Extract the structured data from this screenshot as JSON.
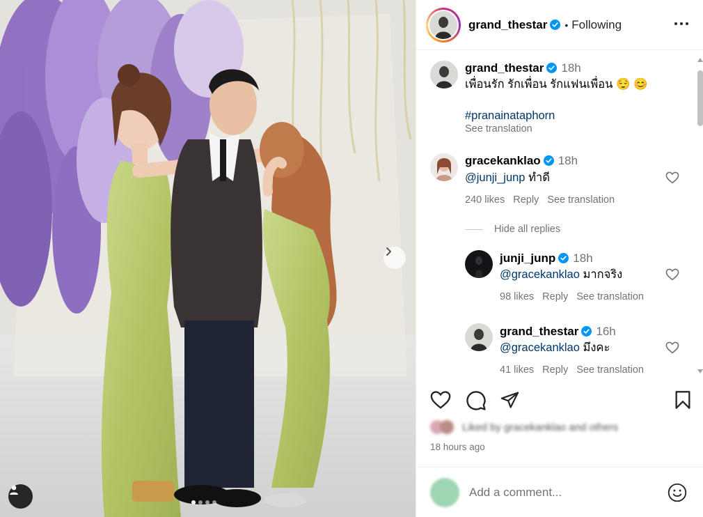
{
  "post": {
    "author": "grand_thestar",
    "separator": "•",
    "follow_status": "Following",
    "photo_count": 4,
    "active_photo": 1
  },
  "caption": {
    "username": "grand_thestar",
    "time": "18h",
    "text": "เพื่อนรัก รักเพื่อน รักแฟนเพื่อน 😌 😊",
    "hashtag": "#pranainataphorn",
    "translate": "See translation"
  },
  "comments": [
    {
      "username": "gracekankla o",
      "display": "gracekanklao",
      "time": "18h",
      "mention": "@junji_junp",
      "text": "ทำดี",
      "likes": "240 likes",
      "reply": "Reply",
      "translate": "See translation",
      "hide_replies": "Hide all replies"
    },
    {
      "username": "junji_junp",
      "time": "18h",
      "mention": "@gracekanklao",
      "text": "มากจริง",
      "likes": "98 likes",
      "reply": "Reply",
      "translate": "See translation"
    },
    {
      "username": "grand_thestar",
      "time": "16h",
      "mention": "@gracekanklao",
      "text": "มึงคะ",
      "likes": "41 likes",
      "reply": "Reply",
      "translate": "See translation"
    }
  ],
  "footer": {
    "liked_by": "Liked by gracekanklao and others",
    "posted": "18 hours ago",
    "add_comment_placeholder": "Add a comment..."
  },
  "icons": {
    "verified": "verified-badge-icon",
    "more": "more-options-icon",
    "like": "heart-icon",
    "comment": "comment-icon",
    "share": "share-icon",
    "save": "bookmark-icon",
    "emoji": "emoji-icon",
    "next": "chevron-right-icon",
    "tags": "user-tag-icon"
  },
  "colors": {
    "verified": "#0095f6",
    "link": "#00376b",
    "muted": "#737373",
    "dress": "#b5c66a"
  }
}
